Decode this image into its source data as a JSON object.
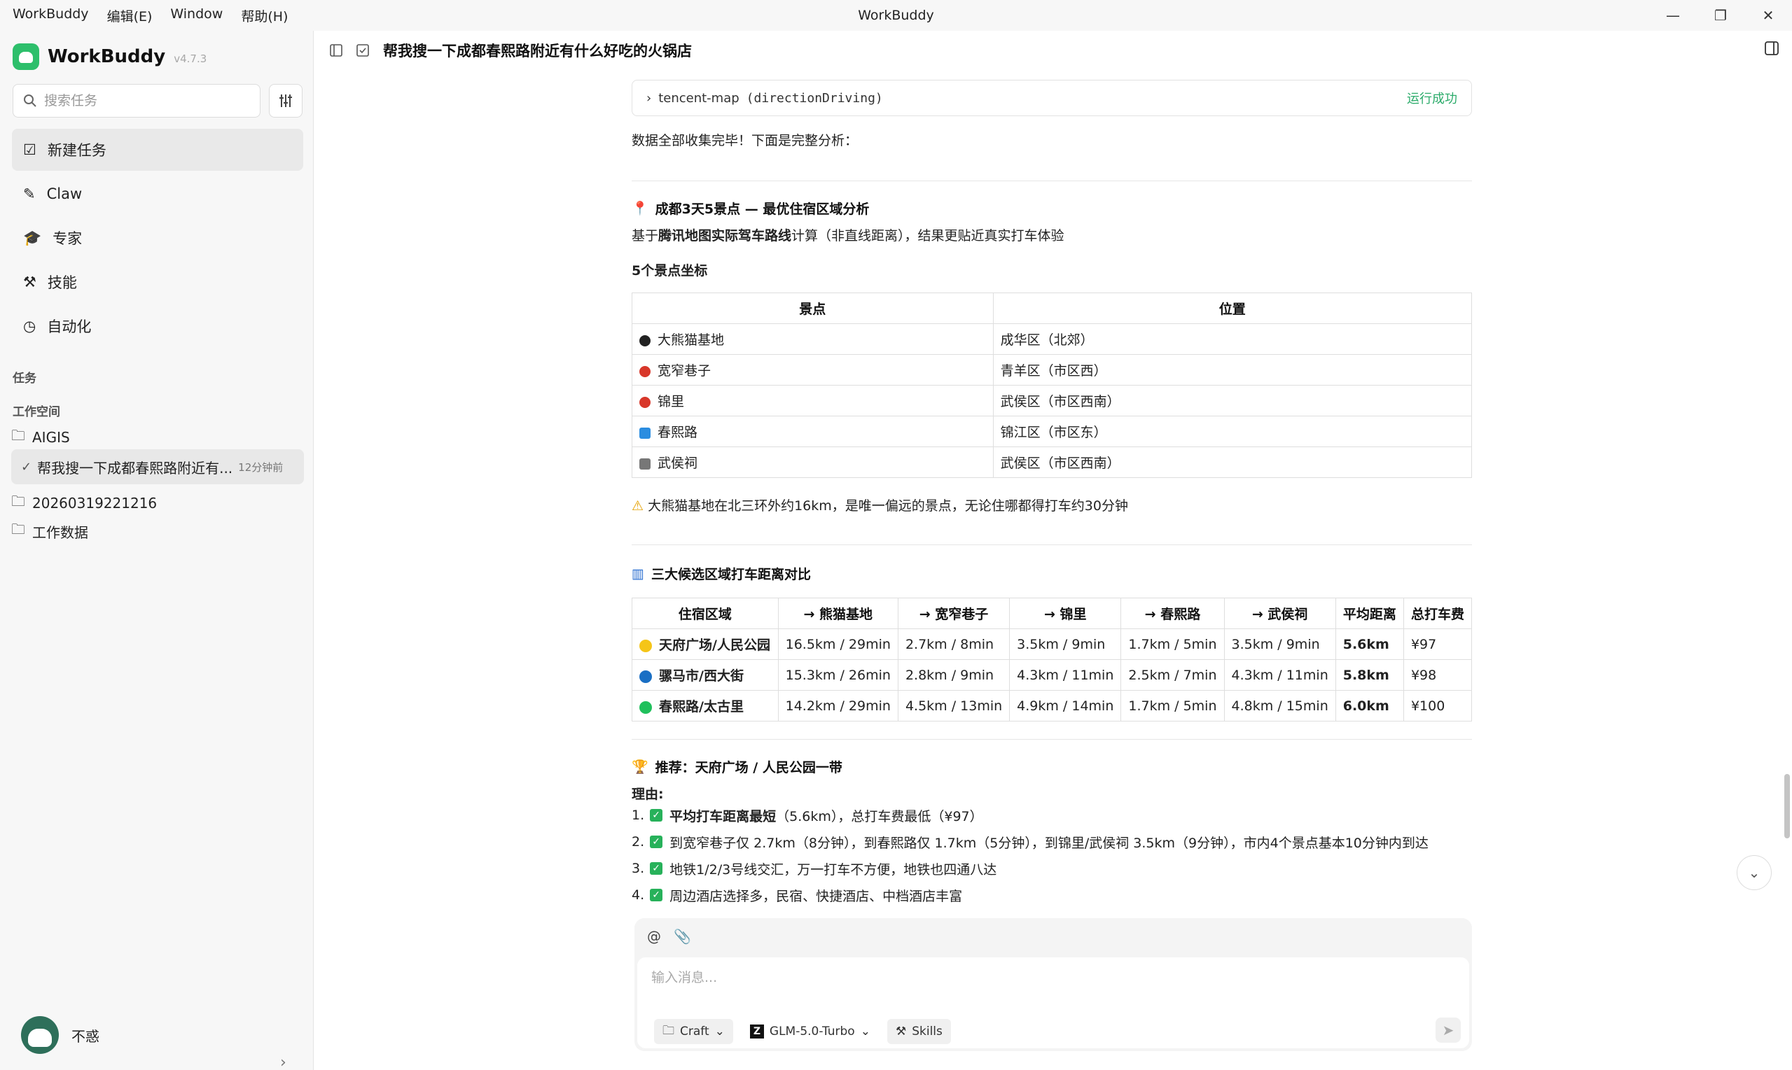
{
  "titlebar": {
    "menu": [
      "WorkBuddy",
      "编辑(E)",
      "Window",
      "帮助(H)"
    ],
    "window_title": "WorkBuddy"
  },
  "sidebar": {
    "app_name": "WorkBuddy",
    "version": "v4.7.3",
    "search_placeholder": "搜索任务",
    "nav": [
      {
        "label": "新建任务",
        "icon": "new-task-icon"
      },
      {
        "label": "Claw",
        "icon": "claw-icon"
      },
      {
        "label": "专家",
        "icon": "expert-icon"
      },
      {
        "label": "技能",
        "icon": "skills-icon"
      },
      {
        "label": "自动化",
        "icon": "clock-icon"
      }
    ],
    "tasks_label": "任务",
    "workspace_label": "工作空间",
    "workspaces": [
      "AIGIS",
      "20260319221216",
      "工作数据"
    ],
    "active_task": {
      "title": "帮我搜一下成都春熙路附近有...",
      "time": "12分钟前"
    },
    "user_name": "不惑"
  },
  "header": {
    "title": "帮我搜一下成都春熙路附近有什么好吃的火锅店"
  },
  "content": {
    "tool_call": {
      "name": "tencent-map",
      "fn": "(directionDriving)",
      "status": "运行成功"
    },
    "intro": "数据全部收集完毕！下面是完整分析：",
    "section1_title": "成都3天5景点 — 最优住宿区域分析",
    "section1_desc_pre": "基于",
    "section1_desc_bold": "腾讯地图实际驾车路线",
    "section1_desc_post": "计算（非直线距离），结果更贴近真实打车体验",
    "coords_title": "5个景点坐标",
    "table1": {
      "headers": [
        "景点",
        "位置"
      ],
      "rows": [
        {
          "name": "大熊猫基地",
          "loc": "成华区（北郊）"
        },
        {
          "name": "宽窄巷子",
          "loc": "青羊区（市区西）"
        },
        {
          "name": "锦里",
          "loc": "武侯区（市区西南）"
        },
        {
          "name": "春熙路",
          "loc": "锦江区（市区东）"
        },
        {
          "name": "武侯祠",
          "loc": "武侯区（市区西南）"
        }
      ]
    },
    "warning": "大熊猫基地在北三环外约16km，是唯一偏远的景点，无论住哪都得打车约30分钟",
    "section2_title": "三大候选区域打车距离对比",
    "table2": {
      "headers": [
        "住宿区域",
        "→ 熊猫基地",
        "→ 宽窄巷子",
        "→ 锦里",
        "→ 春熙路",
        "→ 武侯祠",
        "平均距离",
        "总打车费"
      ],
      "rows": [
        {
          "color": "#f5c518",
          "area": "天府广场/人民公园",
          "c1": "16.5km / 29min",
          "c2": "2.7km / 8min",
          "c3": "3.5km / 9min",
          "c4": "1.7km / 5min",
          "c5": "3.5km / 9min",
          "avg": "5.6km",
          "fee": "¥97"
        },
        {
          "color": "#1a6fc4",
          "area": "骡马市/西大街",
          "c1": "15.3km / 26min",
          "c2": "2.8km / 9min",
          "c3": "4.3km / 11min",
          "c4": "2.5km / 7min",
          "c5": "4.3km / 11min",
          "avg": "5.8km",
          "fee": "¥98"
        },
        {
          "color": "#20c05c",
          "area": "春熙路/太古里",
          "c1": "14.2km / 29min",
          "c2": "4.5km / 13min",
          "c3": "4.9km / 14min",
          "c4": "1.7km / 5min",
          "c5": "4.8km / 15min",
          "avg": "6.0km",
          "fee": "¥100"
        }
      ]
    },
    "recommend_title": "推荐：天府广场 / 人民公园一带",
    "reason_label": "理由",
    "reasons": [
      {
        "num": "1.",
        "bold": "平均打车距离最短",
        "text": "（5.6km），总打车费最低（¥97）"
      },
      {
        "num": "2.",
        "bold": "",
        "text": "到宽窄巷子仅 2.7km（8分钟），到春熙路仅 1.7km（5分钟），到锦里/武侯祠 3.5km（9分钟），市内4个景点基本10分钟内到达"
      },
      {
        "num": "3.",
        "bold": "",
        "text": "地铁1/2/3号线交汇，万一打车不方便，地铁也四通八达"
      },
      {
        "num": "4.",
        "bold": "",
        "text": "周边酒店选择多，民宿、快捷酒店、中档酒店丰富"
      }
    ]
  },
  "composer": {
    "placeholder": "输入消息...",
    "mode": "Craft",
    "model": "GLM-5.0-Turbo",
    "skills": "Skills"
  }
}
